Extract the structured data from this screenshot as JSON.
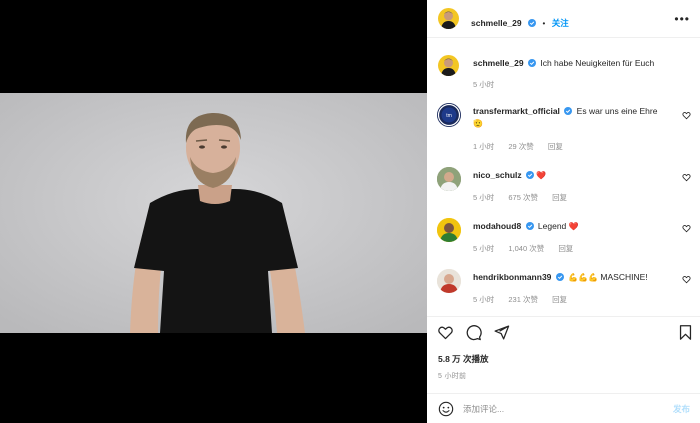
{
  "post_author": {
    "username": "schmelle_29",
    "follow_label": "关注"
  },
  "caption": {
    "username": "schmelle_29",
    "text": "Ich habe Neuigkeiten für Euch",
    "time": "5 小时"
  },
  "comments": [
    {
      "username": "transfermarkt_official",
      "text": "Es war uns eine Ehre",
      "emoji": "🫡",
      "time": "1 小时",
      "likes": "29 次赞",
      "reply": "回复"
    },
    {
      "username": "nico_schulz",
      "text": "",
      "emoji": "❤️",
      "time": "5 小时",
      "likes": "675 次赞",
      "reply": "回复"
    },
    {
      "username": "modahoud8",
      "text": "Legend",
      "emoji": "❤️",
      "time": "5 小时",
      "likes": "1,040 次赞",
      "reply": "回复"
    },
    {
      "username": "hendrikbonmann39",
      "text": "MASCHINE!",
      "emoji": "💪💪💪",
      "time": "5 小时",
      "likes": "231 次赞",
      "reply": "回复"
    }
  ],
  "stats": {
    "views": "5.8 万 次播放",
    "posted": "5 小时前"
  },
  "add_comment": {
    "placeholder": "添加评论...",
    "post_label": "发布"
  },
  "colors": {
    "accent": "#0095f6",
    "verified": "#3897f0",
    "heart": "#ed4956"
  }
}
